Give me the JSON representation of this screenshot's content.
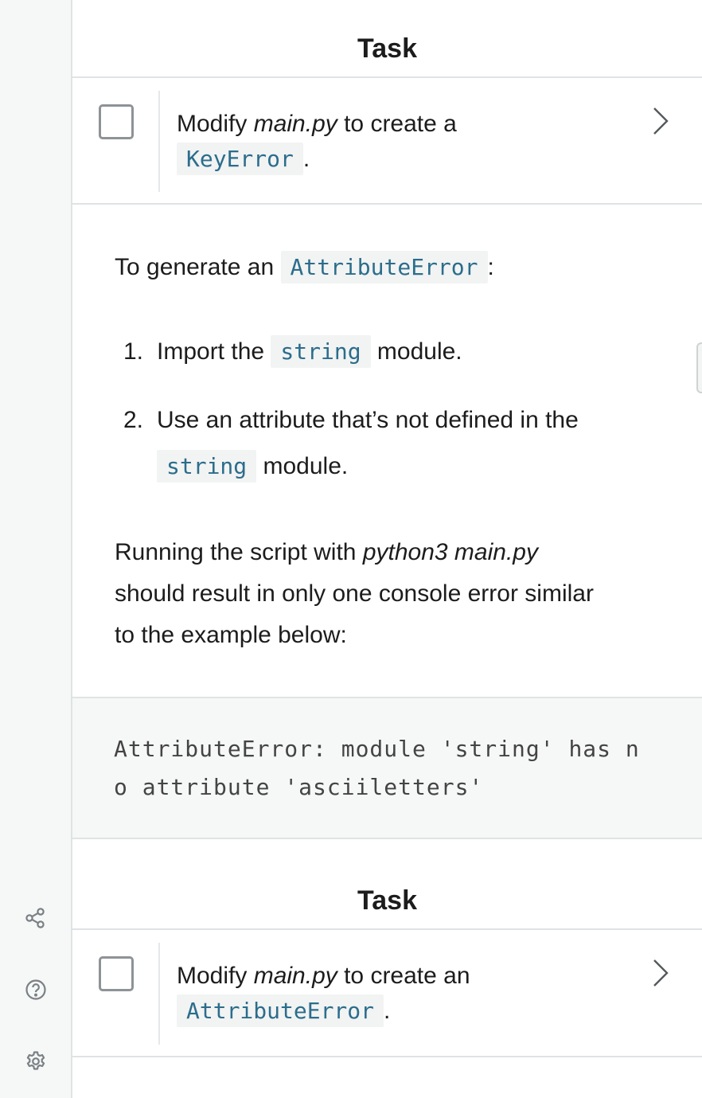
{
  "colors": {
    "code_text": "#2b6d8c",
    "code_bg": "#f2f3f3",
    "rail_bg": "#f6f7f7",
    "border": "#dfe3e4"
  },
  "left_rail": {
    "icons": [
      "share-icon",
      "help-icon",
      "settings-icon"
    ]
  },
  "task1": {
    "header": "Task",
    "text_before": "Modify ",
    "file": "main.py",
    "text_after": " to create a",
    "code": "KeyError",
    "end": "."
  },
  "instructions": {
    "intro_before": "To generate an ",
    "intro_code": "AttributeError",
    "intro_after": ":",
    "steps": [
      {
        "num": "1.",
        "before": "Import the ",
        "code": "string",
        "after": " module."
      },
      {
        "num": "2.",
        "line1": "Use an attribute that’s not defined in the",
        "code": "string",
        "after": " module."
      }
    ],
    "running_before": "Running the script with ",
    "running_cmd": "python3 main.py",
    "running_line2": "should result in only one console error similar",
    "running_line3": "to the example below:"
  },
  "code_example": "AttributeError: module 'string' has n\no attribute 'asciiletters'",
  "task2": {
    "header": "Task",
    "text_before": "Modify ",
    "file": "main.py",
    "text_after": " to create an",
    "code": "AttributeError",
    "end": "."
  }
}
